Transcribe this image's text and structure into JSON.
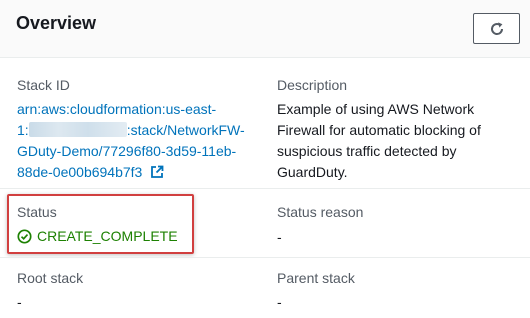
{
  "header": {
    "title": "Overview",
    "refresh_icon": "refresh-icon"
  },
  "stack_id": {
    "label": "Stack ID",
    "line1": "arn:aws:cloudformation:us-east-",
    "line2_prefix": "1:",
    "line2_suffix": ":stack/NetworkFW-",
    "line3": "GDuty-Demo/77296f80-3d59-11eb-",
    "line4": "88de-0e00b694b7f3",
    "external_icon": "external-link-icon"
  },
  "description": {
    "label": "Description",
    "line1": "Example of using AWS Network",
    "line2": "Firewall for automatic blocking of",
    "line3": "suspicious traffic detected by",
    "line4": "GuardDuty."
  },
  "status": {
    "label": "Status",
    "value": "CREATE_COMPLETE",
    "icon": "check-circle-icon",
    "color": "#1d8102"
  },
  "status_reason": {
    "label": "Status reason",
    "value": "-"
  },
  "root_stack": {
    "label": "Root stack",
    "value": "-"
  },
  "parent_stack": {
    "label": "Parent stack",
    "value": "-"
  }
}
